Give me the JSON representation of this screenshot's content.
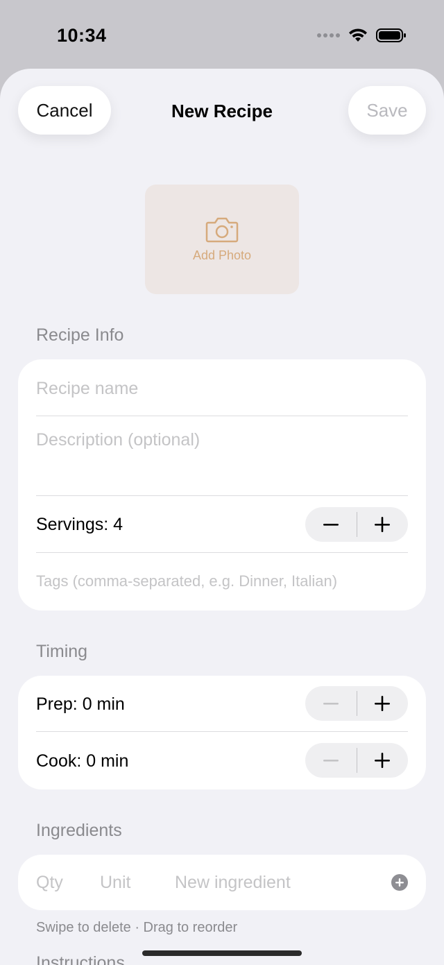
{
  "status": {
    "time": "10:34"
  },
  "nav": {
    "cancel": "Cancel",
    "title": "New Recipe",
    "save": "Save"
  },
  "photo": {
    "label": "Add Photo"
  },
  "recipe_info": {
    "header": "Recipe Info",
    "name_placeholder": "Recipe name",
    "description_placeholder": "Description (optional)",
    "servings_label": "Servings: 4",
    "tags_placeholder": "Tags (comma-separated, e.g. Dinner, Italian)"
  },
  "timing": {
    "header": "Timing",
    "prep_label": "Prep: 0 min",
    "cook_label": "Cook: 0 min"
  },
  "ingredients": {
    "header": "Ingredients",
    "qty_placeholder": "Qty",
    "unit_placeholder": "Unit",
    "name_placeholder": "New ingredient",
    "hint": "Swipe to delete · Drag to reorder"
  },
  "instructions": {
    "header": "Instructions"
  },
  "colors": {
    "accent": "#d6aa7c",
    "background": "#f1f1f6",
    "secondary_text": "#8a8a8e"
  }
}
